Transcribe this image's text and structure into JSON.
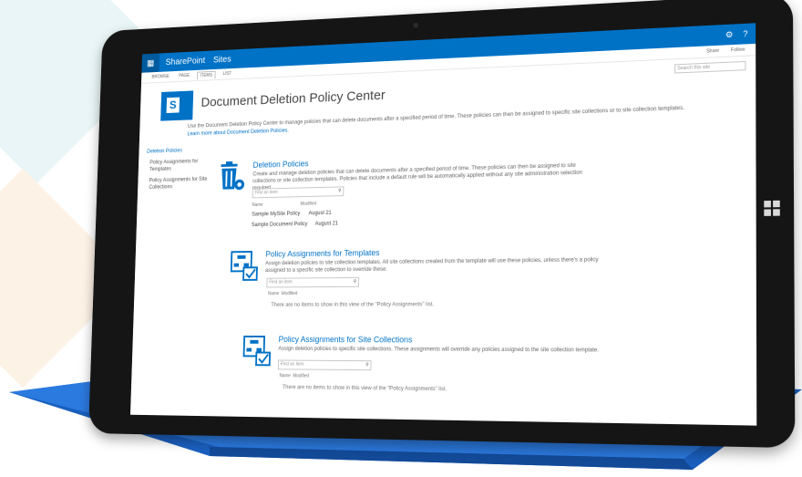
{
  "suite_bar": {
    "app_name": "SharePoint",
    "sites_label": "Sites",
    "settings_icon": "gear-icon",
    "help_label": "?",
    "waffle_icon": "app-launcher-icon"
  },
  "ribbon": {
    "tabs": [
      "BROWSE",
      "PAGE",
      "ITEMS",
      "LIST"
    ],
    "share_label": "Share",
    "follow_label": "Follow"
  },
  "search": {
    "placeholder": "Search this site"
  },
  "page": {
    "title": "Document Deletion Policy Center",
    "intro": "Use the Document Deletion Policy Center to manage policies that can delete documents after a specified period of time. These policies can then be assigned to specific site collections or to site collection templates.",
    "intro_link": "Learn more about Document Deletion Policies."
  },
  "left_nav": {
    "items": [
      {
        "label": "Deletion Policies"
      },
      {
        "label": "Policy Assignments for Templates"
      },
      {
        "label": "Policy Assignments for Site Collections"
      }
    ]
  },
  "sections": {
    "deletion_policies": {
      "title": "Deletion Policies",
      "description": "Create and manage deletion policies that can delete documents after a specified period of time. These policies can then be assigned to site collections or site collection templates. Policies that include a default rule will be automatically applied without any site administration selection required.",
      "find_placeholder": "Find an item",
      "columns": [
        "Name",
        "Modified"
      ],
      "rows": [
        {
          "name": "Sample MySite Policy",
          "modified": "August 21"
        },
        {
          "name": "Sample Document Policy",
          "modified": "August 21"
        }
      ]
    },
    "templates": {
      "title": "Policy Assignments for Templates",
      "description": "Assign deletion policies to site collection templates. All site collections created from the template will use these policies, unless there's a policy assigned to a specific site collection to override these.",
      "find_placeholder": "Find an item",
      "columns": [
        "Name",
        "Modified"
      ],
      "empty_text": "There are no items to show in this view of the \"Policy Assignments\" list."
    },
    "site_collections": {
      "title": "Policy Assignments for Site Collections",
      "description": "Assign deletion policies to specific site collections. These assignments will override any policies assigned to the site collection template.",
      "find_placeholder": "Find an item",
      "columns": [
        "Name",
        "Modified"
      ],
      "empty_text": "There are no items to show in this view of the \"Policy Assignments\" list."
    }
  },
  "colors": {
    "brand_blue": "#0072c6",
    "cover_blue": "#1f6fd1",
    "tablet_black": "#151515"
  }
}
